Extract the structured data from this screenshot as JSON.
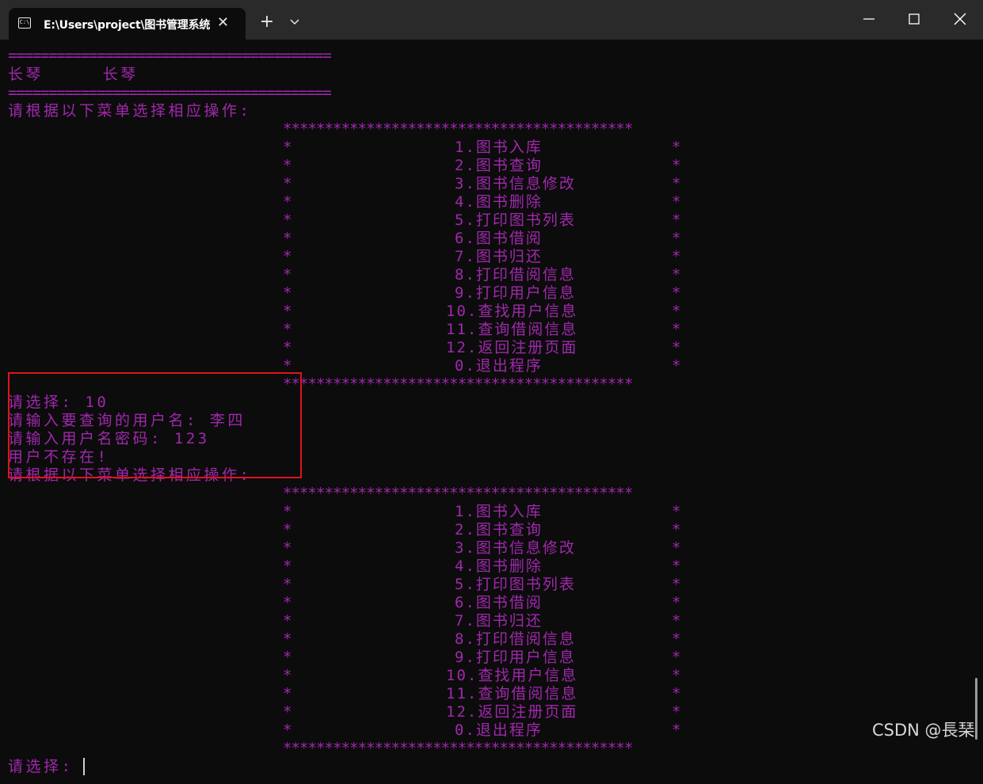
{
  "window": {
    "tab_icon_text": "C:\\",
    "tab_title": "E:\\Users\\project\\图书管理系统",
    "close_tab_glyph": "✕",
    "new_tab_glyph": "+"
  },
  "terminal": {
    "separator": "========================================",
    "header": "长琴     长琴",
    "prompt_menu": "请根据以下菜单选择相应操作:",
    "menu_border": "******************************************",
    "menu_items": [
      "1.图书入库",
      "2.图书查询",
      "3.图书信息修改",
      "4.图书删除",
      "5.打印图书列表",
      "6.图书借阅",
      "7.图书归还",
      "8.打印借阅信息",
      "9.打印用户信息",
      "10.查找用户信息",
      "11.查询借阅信息",
      "12.返回注册页面",
      "0.退出程序"
    ],
    "session": {
      "choose_line": "请选择: 10",
      "query_user_line": "请输入要查询的用户名: 李四",
      "password_line": "请输入用户名密码: 123",
      "result_line": "用户不存在!"
    },
    "final_prompt": "请选择: "
  },
  "watermark": "CSDN @長琹",
  "colors": {
    "terminal_bg": "#0c0c0c",
    "terminal_text": "#a028ad",
    "titlebar_bg": "#2a2a2a",
    "highlight_border": "#e0141c"
  }
}
